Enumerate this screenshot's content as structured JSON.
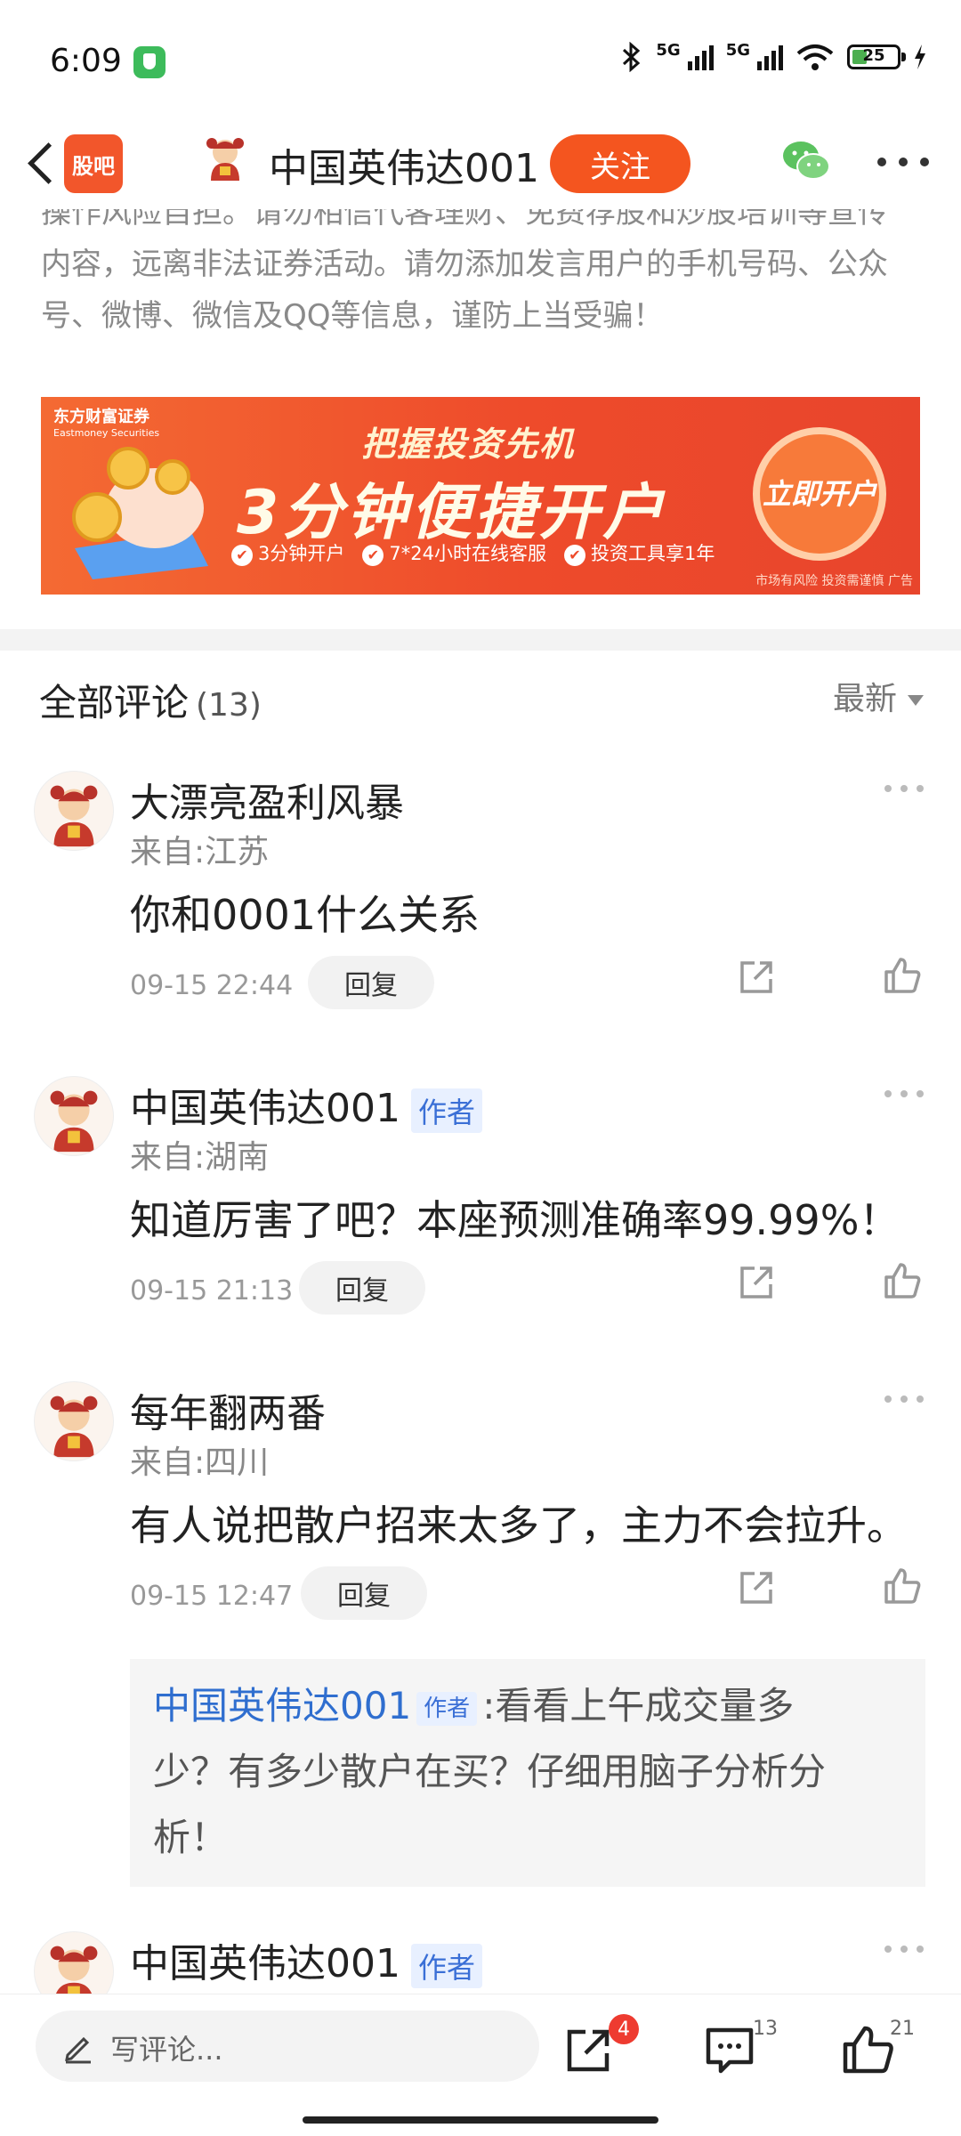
{
  "status_bar": {
    "time": "6:09",
    "net1": "5G",
    "net2": "5G",
    "battery": "25"
  },
  "header": {
    "logo": "股吧",
    "title": "中国英伟达001",
    "follow": "关注"
  },
  "disclaimer": {
    "lines": [
      "操作风险自担。请勿相信代客理财、免费荐股和炒股培训等宣传",
      "内容，远离非法证券活动。请勿添加发言用户的手机号码、公众",
      "号、微博、微信及QQ等信息，谨防上当受骗！"
    ]
  },
  "ad": {
    "brand": "东方财富证券",
    "brand_en": "Eastmoney Securities",
    "tagline": "把握投资先机",
    "headline": "3分钟便捷开户",
    "features": [
      "3分钟开户",
      "7*24小时在线客服",
      "投资工具享1年"
    ],
    "badge": "立即开户",
    "risk": "市场有风险 投资需谨慎 广告"
  },
  "comments_section": {
    "title": "全部评论",
    "count": "(13)",
    "sort": "最新"
  },
  "comments": [
    {
      "name": "大漂亮盈利风暴",
      "author_tag": "",
      "location": "来自:江苏",
      "text": "你和0001什么关系",
      "time": "09-15 22:44",
      "reply_label": "回复"
    },
    {
      "name": "中国英伟达001",
      "author_tag": "作者",
      "location": "来自:湖南",
      "text": "知道厉害了吧？本座预测准确率99.99%！",
      "time": "09-15 21:13",
      "reply_label": "回复"
    },
    {
      "name": "每年翻两番",
      "author_tag": "",
      "location": "来自:四川",
      "text": "有人说把散户招来太多了，主力不会拉升。",
      "time": "09-15 12:47",
      "reply_label": "回复",
      "reply": {
        "name": "中国英伟达001",
        "tag": "作者",
        "lines": [
          ":看看上午成交量多",
          "少？有多少散户在买？仔细用脑子分析分",
          "析！"
        ]
      }
    },
    {
      "name": "中国英伟达001",
      "author_tag": "作者"
    }
  ],
  "bottom_bar": {
    "input_placeholder": "写评论...",
    "share_badge": "4",
    "comment_count": "13",
    "like_count": "21"
  },
  "colors": {
    "accent": "#f4551f",
    "author_blue": "#3a6fd6"
  }
}
